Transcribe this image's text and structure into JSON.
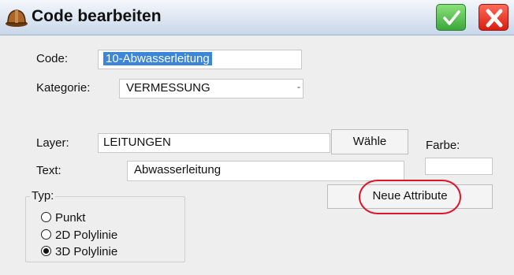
{
  "window": {
    "title": "Code bearbeiten"
  },
  "form": {
    "code_label": "Code:",
    "code_value": "10-Abwasserleitung",
    "kategorie_label": "Kategorie:",
    "kategorie_value": "VERMESSUNG",
    "layer_label": "Layer:",
    "layer_value": "LEITUNGEN",
    "waehle_label": "Wähle",
    "farbe_label": "Farbe:",
    "text_label": "Text:",
    "text_value": "Abwasserleitung",
    "neue_attribute_label": "Neue Attribute"
  },
  "typ": {
    "label": "Typ:",
    "options": [
      {
        "label": "Punkt",
        "checked": false
      },
      {
        "label": "2D Polylinie",
        "checked": false
      },
      {
        "label": "3D Polylinie",
        "checked": true
      }
    ]
  },
  "colors": {
    "ok": "#3aa83a",
    "cancel": "#d81e10",
    "highlight": "#e0142a",
    "selection": "#3b86d8"
  }
}
